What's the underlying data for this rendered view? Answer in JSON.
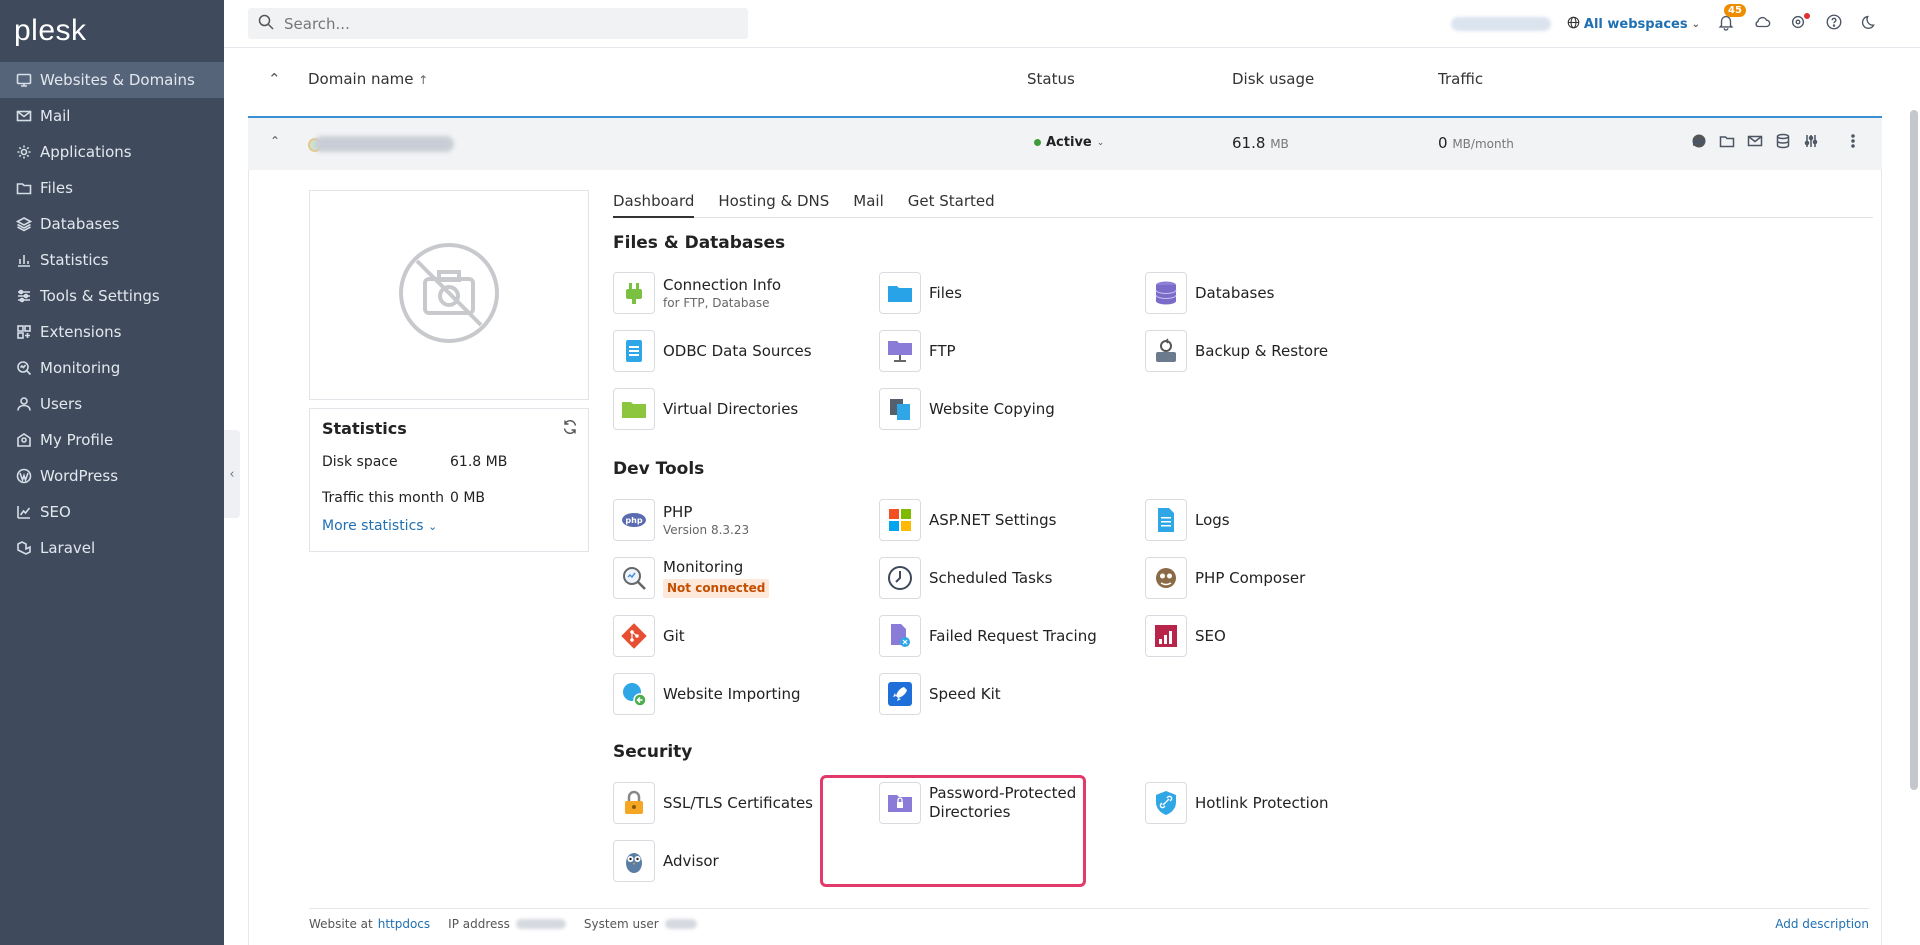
{
  "brand": {
    "logo": "plesk"
  },
  "sidebar": {
    "items": [
      {
        "label": "Websites & Domains",
        "icon": "monitor-icon",
        "active": true
      },
      {
        "label": "Mail",
        "icon": "mail-icon"
      },
      {
        "label": "Applications",
        "icon": "gear-icon"
      },
      {
        "label": "Files",
        "icon": "folder-icon"
      },
      {
        "label": "Databases",
        "icon": "layers-icon"
      },
      {
        "label": "Statistics",
        "icon": "bar-chart-icon"
      },
      {
        "label": "Tools & Settings",
        "icon": "sliders-icon"
      },
      {
        "label": "Extensions",
        "icon": "grid-icon"
      },
      {
        "label": "Monitoring",
        "icon": "monitoring-icon"
      },
      {
        "label": "Users",
        "icon": "user-icon"
      },
      {
        "label": "My Profile",
        "icon": "profile-icon"
      },
      {
        "label": "WordPress",
        "icon": "wordpress-icon"
      },
      {
        "label": "SEO",
        "icon": "seo-icon"
      },
      {
        "label": "Laravel",
        "icon": "laravel-icon"
      }
    ]
  },
  "topbar": {
    "search_placeholder": "Search...",
    "webspaces_label": "All webspaces",
    "notifications_count": "45"
  },
  "table": {
    "columns": {
      "domain": "Domain name",
      "status": "Status",
      "disk": "Disk usage",
      "traffic": "Traffic"
    },
    "row": {
      "status": "Active",
      "disk_value": "61.8",
      "disk_unit": "MB",
      "traffic_value": "0",
      "traffic_unit": "MB/month"
    }
  },
  "stats": {
    "title": "Statistics",
    "disk_label": "Disk space",
    "disk_value": "61.8 MB",
    "traffic_label": "Traffic this month",
    "traffic_value": "0 MB",
    "more": "More statistics"
  },
  "tabs": [
    "Dashboard",
    "Hosting & DNS",
    "Mail",
    "Get Started"
  ],
  "sections": {
    "files": "Files & Databases",
    "dev": "Dev Tools",
    "security": "Security"
  },
  "tools": {
    "connection_info": {
      "label": "Connection Info",
      "sub": "for FTP, Database"
    },
    "files": {
      "label": "Files"
    },
    "databases": {
      "label": "Databases"
    },
    "odbc": {
      "label": "ODBC Data Sources"
    },
    "ftp": {
      "label": "FTP"
    },
    "backup": {
      "label": "Backup & Restore"
    },
    "virtual_dirs": {
      "label": "Virtual Directories"
    },
    "website_copying": {
      "label": "Website Copying"
    },
    "php": {
      "label": "PHP",
      "sub": "Version 8.3.23"
    },
    "aspnet": {
      "label": "ASP.NET Settings"
    },
    "logs": {
      "label": "Logs"
    },
    "monitoring": {
      "label": "Monitoring",
      "badge": "Not connected"
    },
    "scheduled": {
      "label": "Scheduled Tasks"
    },
    "composer": {
      "label": "PHP Composer"
    },
    "git": {
      "label": "Git"
    },
    "failed_req": {
      "label": "Failed Request Tracing"
    },
    "seo": {
      "label": "SEO"
    },
    "importing": {
      "label": "Website Importing"
    },
    "speedkit": {
      "label": "Speed Kit"
    },
    "ssl": {
      "label": "SSL/TLS Certificates"
    },
    "pwd_dirs": {
      "label": "Password-Protected Directories"
    },
    "hotlink": {
      "label": "Hotlink Protection"
    },
    "advisor": {
      "label": "Advisor"
    }
  },
  "footer": {
    "website_at": "Website at",
    "httpdocs": "httpdocs",
    "ip_label": "IP address",
    "sysuser_label": "System user",
    "add_description": "Add description"
  }
}
